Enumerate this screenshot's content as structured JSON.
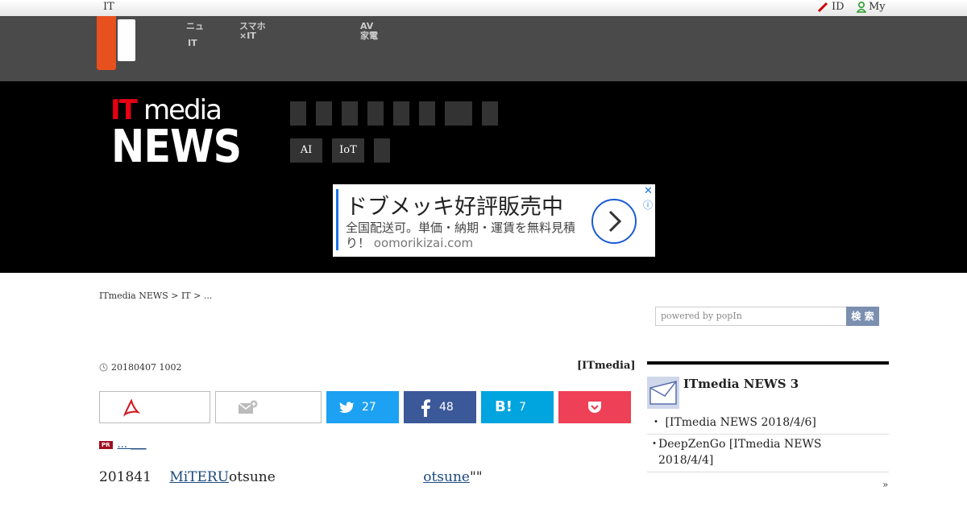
{
  "topbar": {
    "left_label": "IT",
    "id_label": "ID",
    "my_label": "My"
  },
  "nav": {
    "item1_line1": "ニュ",
    "item1_line2": "IT",
    "item2_line1": "スマホ",
    "item2_line2": "×IT",
    "item3_line1": "AV",
    "item3_line2": "家電"
  },
  "header": {
    "logo_it": "IT",
    "logo_media": "media",
    "logo_news": "NEWS",
    "tags": [
      "AI",
      "IoT",
      ""
    ]
  },
  "ad": {
    "headline": "ドブメッキ好評販売中",
    "body": "全国配送可。単価・納期・運賃を無料見積り！",
    "url": "oomorikizai.com",
    "close": "✕",
    "info": "ⓘ"
  },
  "breadcrumb": "ITmedia NEWS > IT > ...",
  "search": {
    "placeholder": "powered by popIn",
    "button": "検 索"
  },
  "article": {
    "date": "20180407 1002",
    "source": "[ITmedia]",
    "share": {
      "twitter_count": "27",
      "facebook_count": "48",
      "hatena_count": "7"
    },
    "pr_text": "... ___",
    "body_pre": "201841",
    "link1": "MiTERU",
    "body_mid": "otsune",
    "link2": "otsune",
    "body_post": "\"\""
  },
  "sidebar": {
    "ranking_title": "ITmedia NEWS 3",
    "items": [
      "  [ITmedia NEWS   2018/4/6]",
      "DeepZenGo [ITmedia NEWS 2018/4/4]"
    ],
    "more": "»"
  },
  "colors": {
    "brand_red": "#e60012",
    "nav_orange": "#e8501e",
    "twitter": "#1da1f2",
    "facebook": "#3b5998",
    "hatena": "#00a4de",
    "pocket": "#ee4056"
  }
}
